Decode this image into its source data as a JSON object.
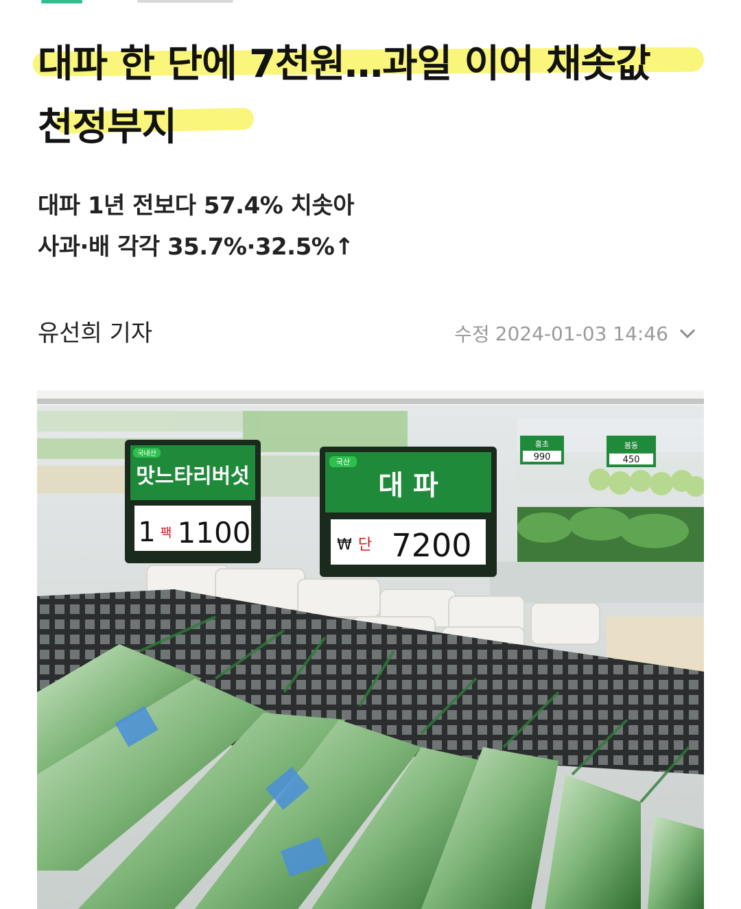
{
  "article": {
    "headline_line1": "대파 한 단에 7천원…과일 이어 채솟값",
    "headline_line2": "천정부지",
    "subtitle_line1": "대파 1년 전보다 57.4% 치솟아",
    "subtitle_line2": "사과·배 각각 35.7%·32.5%↑",
    "author": "유선희 기자",
    "modified_label": "수정",
    "modified_time": "2024-01-03 14:46"
  },
  "photo": {
    "sign_left": {
      "origin": "국내산",
      "name": "맛느타리버섯",
      "unit_qty": "1",
      "unit": "팩",
      "price": "1100"
    },
    "sign_right": {
      "origin": "국산",
      "name": "대 파",
      "currency": "₩",
      "unit": "단",
      "price": "7200"
    },
    "sign_far_1": {
      "name": "홍초",
      "price": "990"
    },
    "sign_far_2": {
      "name": "봄동",
      "price": "450"
    }
  },
  "colors": {
    "highlight": "#f7f45a",
    "sign_green": "#1f8a3a",
    "meta_gray": "#9a9a9a"
  },
  "icons": {
    "expand": "chevron-down-icon"
  }
}
